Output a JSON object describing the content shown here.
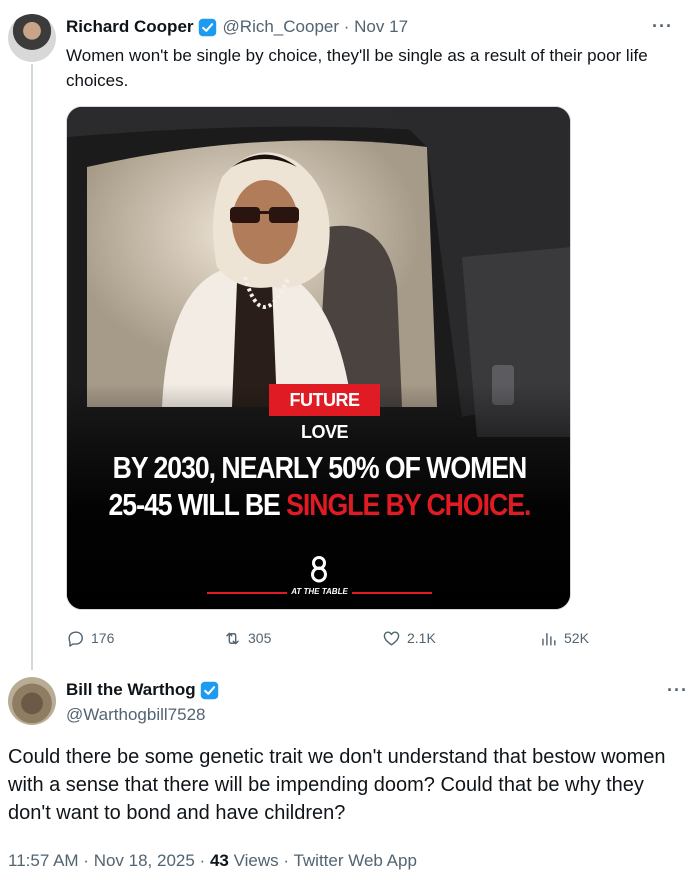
{
  "tweet1": {
    "name": "Richard Cooper",
    "handle": "@Rich_Cooper",
    "separator": "·",
    "date": "Nov 17",
    "text": "Women won't be single by choice, they'll be single as a result of their poor life choices.",
    "more": "···",
    "media": {
      "badge": "FUTURE LOVE",
      "headline_line1": "BY 2030, NEARLY 50% OF WOMEN",
      "headline_line2_prefix": "25-45 WILL BE ",
      "headline_line2_red": "SINGLE BY CHOICE.",
      "brand_mark": "8",
      "brand_name": "AT THE TABLE"
    },
    "actions": {
      "replies": "176",
      "retweets": "305",
      "likes": "2.1K",
      "views": "52K"
    }
  },
  "tweet2": {
    "name": "Bill the Warthog",
    "handle": "@Warthogbill7528",
    "more": "···",
    "text": "Could there be some genetic trait we don't understand that bestow women with a sense that there will be impending doom?  Could that be why they don't want to bond and have children?",
    "time": "11:57 AM",
    "separator1": " · ",
    "date": "Nov 18, 2025",
    "separator2": " · ",
    "views_count": "43",
    "views_label": " Views",
    "separator3": " · ",
    "source": "Twitter Web App"
  },
  "colors": {
    "accent": "#1d9bf0",
    "muted": "#536471",
    "text": "#0f1419",
    "red": "#e01b24"
  }
}
